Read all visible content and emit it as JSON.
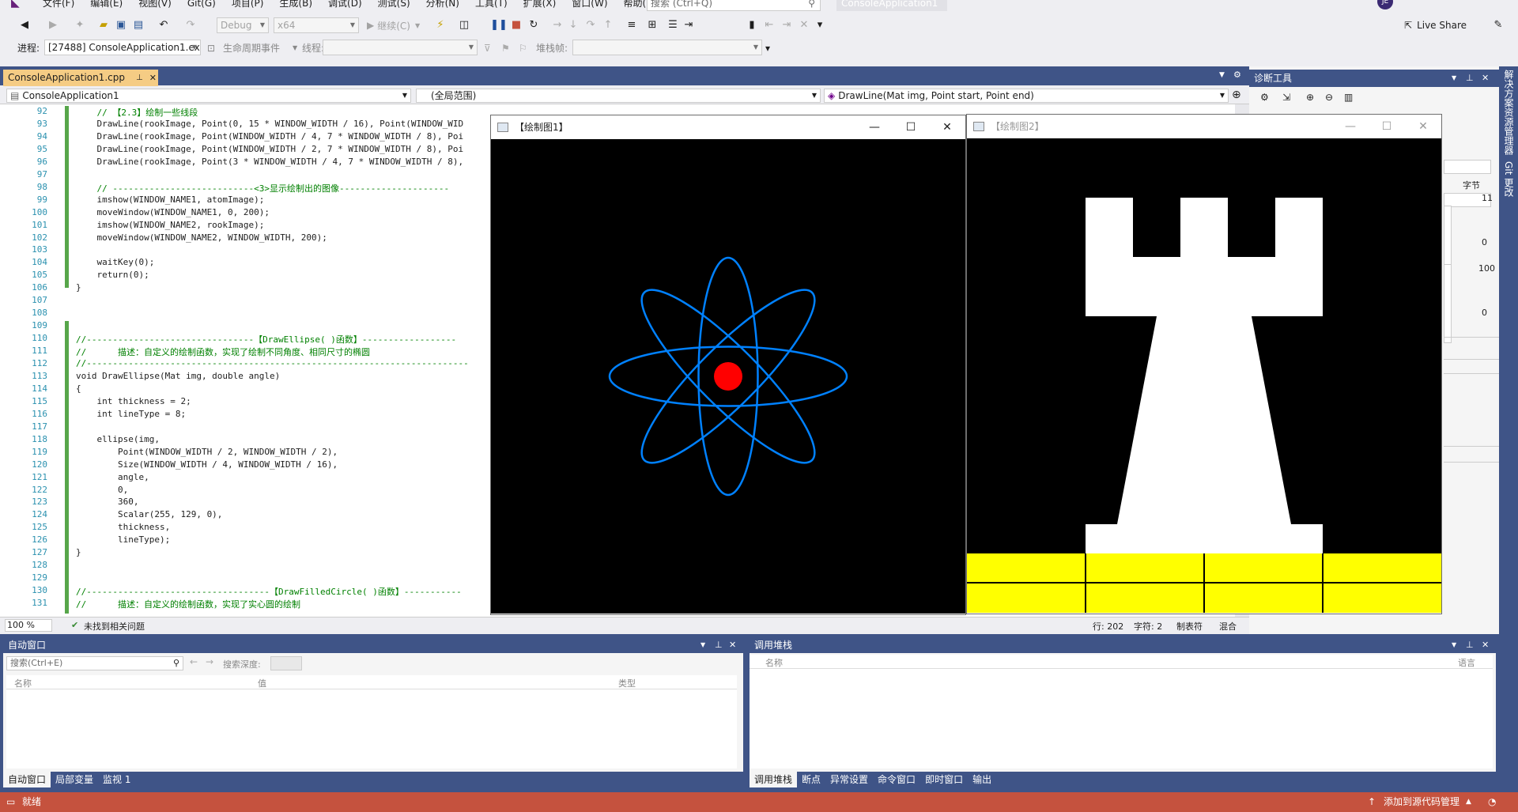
{
  "menubar": {
    "items": [
      "文件(F)",
      "编辑(E)",
      "视图(V)",
      "Git(G)",
      "项目(P)",
      "生成(B)",
      "调试(D)",
      "测试(S)",
      "分析(N)",
      "工具(T)",
      "扩展(X)",
      "窗口(W)",
      "帮助(H)"
    ],
    "search_placeholder": "搜索 (Ctrl+Q)",
    "solution_name": "ConsoleApplication1",
    "user_initials": "JE"
  },
  "toolbar1": {
    "config": "Debug",
    "platform": "x64",
    "continue_label": "继续(C)",
    "live_share": "Live Share"
  },
  "toolbar2": {
    "process_label": "进程:",
    "process_value": "[27488] ConsoleApplication1.ex",
    "lifecycle_label": "生命周期事件",
    "thread_label": "线程:",
    "stackframe_label": "堆栈帧:"
  },
  "editor": {
    "tab_label": "ConsoleApplication1.cpp",
    "nav_project": "ConsoleApplication1",
    "nav_scope": "(全局范围)",
    "nav_member": "DrawLine(Mat img, Point start, Point end)",
    "zoom": "100 %",
    "issues": "未找到相关问题",
    "line": "行: 202",
    "char": "字符: 2",
    "tab_mode": "制表符",
    "eol": "混合"
  },
  "code_lines": [
    {
      "n": "92",
      "t": "    // 【2.3】绘制一些线段"
    },
    {
      "n": "93",
      "t": "    DrawLine(rookImage, Point(0, 15 * WINDOW_WIDTH / 16), Point(WINDOW_WID"
    },
    {
      "n": "94",
      "t": "    DrawLine(rookImage, Point(WINDOW_WIDTH / 4, 7 * WINDOW_WIDTH / 8), Poi"
    },
    {
      "n": "95",
      "t": "    DrawLine(rookImage, Point(WINDOW_WIDTH / 2, 7 * WINDOW_WIDTH / 8), Poi"
    },
    {
      "n": "96",
      "t": "    DrawLine(rookImage, Point(3 * WINDOW_WIDTH / 4, 7 * WINDOW_WIDTH / 8),"
    },
    {
      "n": "97",
      "t": ""
    },
    {
      "n": "98",
      "t": "    // ---------------------------<3>显示绘制出的图像---------------------"
    },
    {
      "n": "99",
      "t": "    imshow(WINDOW_NAME1, atomImage);"
    },
    {
      "n": "100",
      "t": "    moveWindow(WINDOW_NAME1, 0, 200);"
    },
    {
      "n": "101",
      "t": "    imshow(WINDOW_NAME2, rookImage);"
    },
    {
      "n": "102",
      "t": "    moveWindow(WINDOW_NAME2, WINDOW_WIDTH, 200);"
    },
    {
      "n": "103",
      "t": ""
    },
    {
      "n": "104",
      "t": "    waitKey(0);"
    },
    {
      "n": "105",
      "t": "    return(0);"
    },
    {
      "n": "106",
      "t": "}"
    },
    {
      "n": "107",
      "t": ""
    },
    {
      "n": "108",
      "t": ""
    },
    {
      "n": "109",
      "t": ""
    },
    {
      "n": "110",
      "t": "//--------------------------------【DrawEllipse( )函数】------------------"
    },
    {
      "n": "111",
      "t": "//      描述：自定义的绘制函数，实现了绘制不同角度、相同尺寸的椭圆"
    },
    {
      "n": "112",
      "t": "//-------------------------------------------------------------------------"
    },
    {
      "n": "113",
      "t": "void DrawEllipse(Mat img, double angle)"
    },
    {
      "n": "114",
      "t": "{"
    },
    {
      "n": "115",
      "t": "    int thickness = 2;"
    },
    {
      "n": "116",
      "t": "    int lineType = 8;"
    },
    {
      "n": "117",
      "t": ""
    },
    {
      "n": "118",
      "t": "    ellipse(img,"
    },
    {
      "n": "119",
      "t": "        Point(WINDOW_WIDTH / 2, WINDOW_WIDTH / 2),"
    },
    {
      "n": "120",
      "t": "        Size(WINDOW_WIDTH / 4, WINDOW_WIDTH / 16),"
    },
    {
      "n": "121",
      "t": "        angle,"
    },
    {
      "n": "122",
      "t": "        0,"
    },
    {
      "n": "123",
      "t": "        360,"
    },
    {
      "n": "124",
      "t": "        Scalar(255, 129, 0),"
    },
    {
      "n": "125",
      "t": "        thickness,"
    },
    {
      "n": "126",
      "t": "        lineType);"
    },
    {
      "n": "127",
      "t": "}"
    },
    {
      "n": "128",
      "t": ""
    },
    {
      "n": "129",
      "t": ""
    },
    {
      "n": "130",
      "t": "//-----------------------------------【DrawFilledCircle( )函数】-----------"
    },
    {
      "n": "131",
      "t": "//      描述：自定义的绘制函数，实现了实心圆的绘制"
    }
  ],
  "diagnostics": {
    "title": "诊断工具",
    "bytes_label": "字节",
    "axis_top1": "11",
    "axis_bot1": "0",
    "axis_top2": "100",
    "axis_bot2": "0"
  },
  "right_strip": {
    "solution_explorer": "解决方案资源管理器",
    "git_changes": "Git 更改"
  },
  "autos": {
    "title": "自动窗口",
    "search_placeholder": "搜索(Ctrl+E)",
    "search_depth": "搜索深度:",
    "col_name": "名称",
    "col_value": "值",
    "col_type": "类型",
    "tabs": [
      "自动窗口",
      "局部变量",
      "监视 1"
    ]
  },
  "callstack": {
    "title": "调用堆栈",
    "col_name": "名称",
    "col_lang": "语言",
    "tabs": [
      "调用堆栈",
      "断点",
      "异常设置",
      "命令窗口",
      "即时窗口",
      "输出"
    ]
  },
  "status": {
    "ready": "就绪",
    "add_source": "添加到源代码管理"
  },
  "windows": {
    "win1_title": "【绘制图1】",
    "win2_title": "【绘制图2】"
  },
  "colors": {
    "accent_blue": "#3f5487",
    "status_red": "#c5523e",
    "active_tab": "#f5cc84",
    "ellipse_color": "#0081ff",
    "circle_red": "#ff0000",
    "rook_yellow": "#ffff00"
  }
}
